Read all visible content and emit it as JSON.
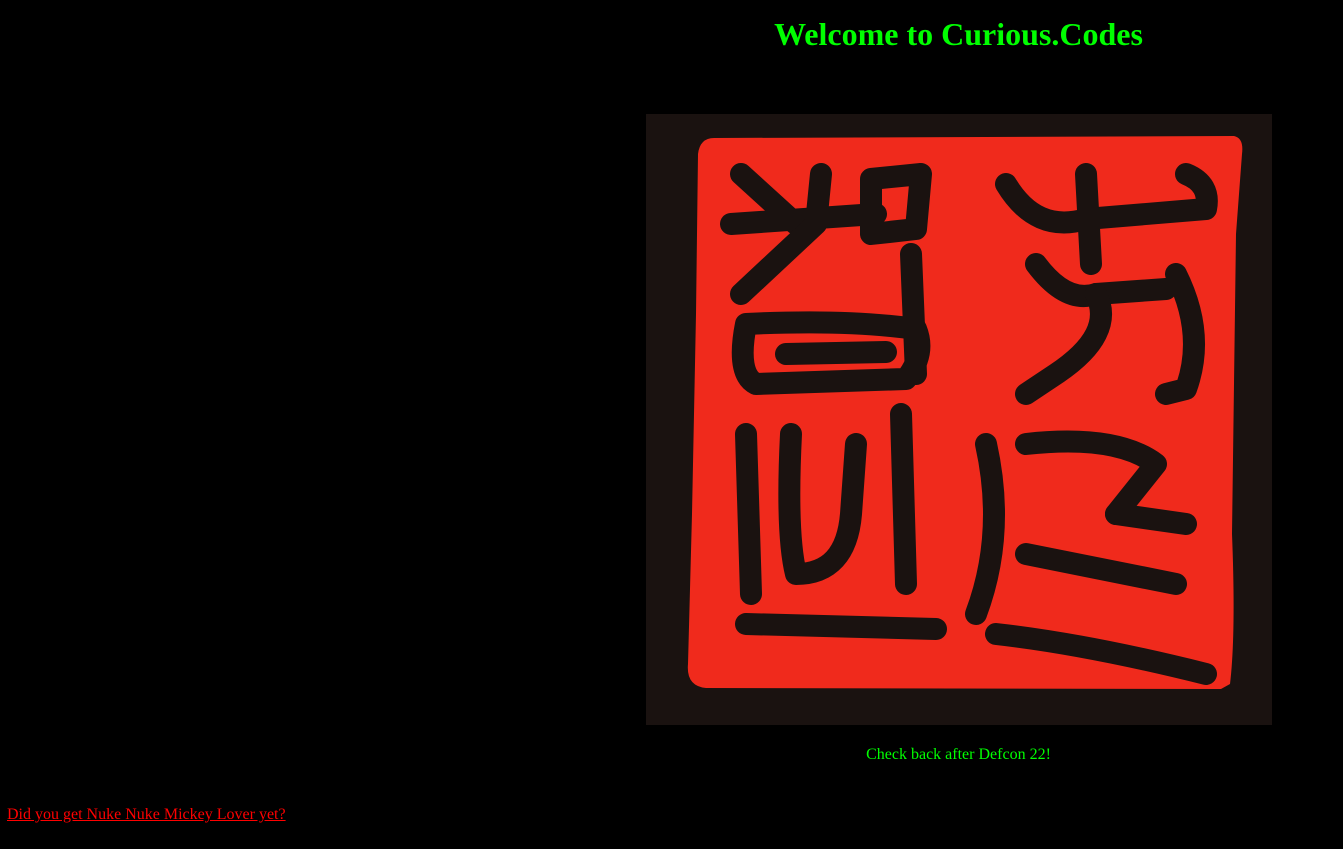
{
  "header": {
    "title": "Welcome to Curious.Codes"
  },
  "seal": {
    "icon": "chinese-seal-stamp-image",
    "inscription": "智者樂水"
  },
  "caption": {
    "text": "Check back after Defcon 22!"
  },
  "footer_link": {
    "text": "Did you get Nuke Nuke Mickey Lover yet?"
  },
  "colors": {
    "background": "#000000",
    "title": "#00ff00",
    "caption": "#00ff00",
    "link": "#ff0000",
    "seal_red": "#f02a1c",
    "seal_ink": "#1a1210"
  }
}
